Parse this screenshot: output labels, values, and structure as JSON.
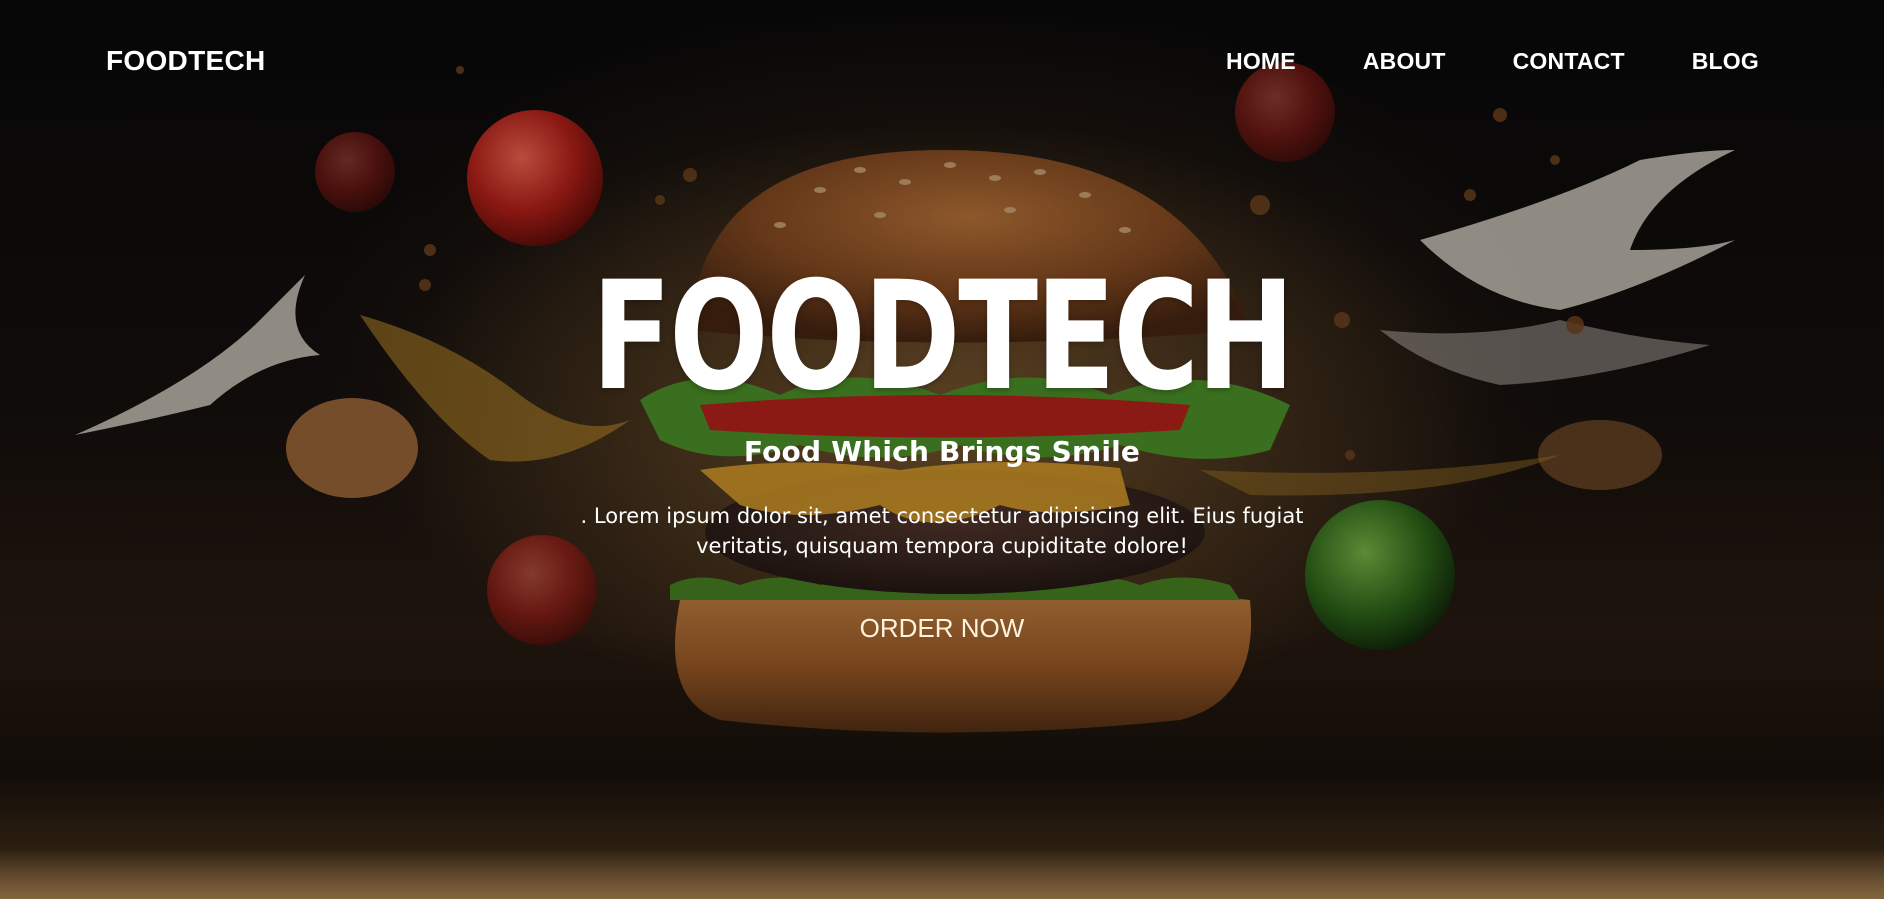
{
  "navbar": {
    "logo": "FOODTECH",
    "links": [
      {
        "label": "HOME"
      },
      {
        "label": "ABOUT"
      },
      {
        "label": "CONTACT"
      },
      {
        "label": "BLOG"
      }
    ]
  },
  "hero": {
    "title": "FOODTECH",
    "subtitle": "Food Which Brings Smile",
    "description": ". Lorem ipsum dolor sit, amet consectetur adipisicing elit. Eius fugiat veritatis, quisquam tempora cupiditate dolore!",
    "cta_label": "ORDER NOW",
    "background_image": "burger-explosion-photo"
  },
  "colors": {
    "text": "#ffffff",
    "cta_text": "#fff3de",
    "background": "#0b0b0c"
  }
}
